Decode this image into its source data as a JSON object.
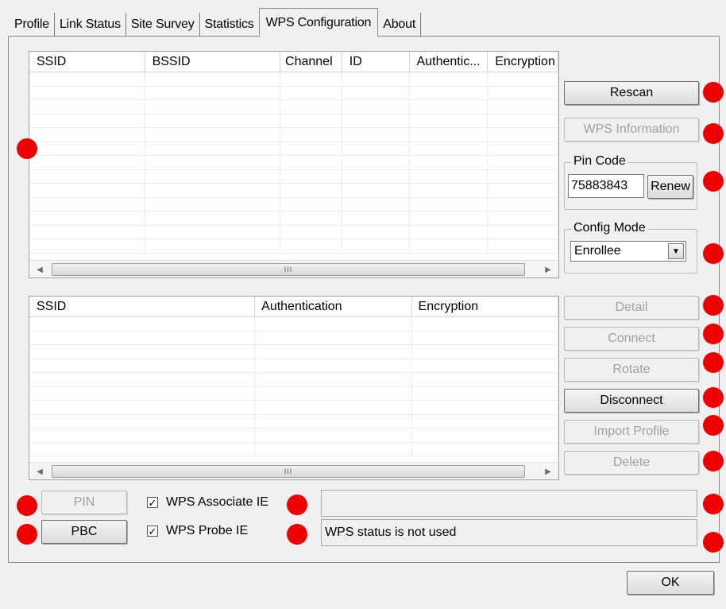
{
  "tabs": [
    {
      "label": "Profile"
    },
    {
      "label": "Link Status"
    },
    {
      "label": "Site Survey"
    },
    {
      "label": "Statistics"
    },
    {
      "label": "WPS Configuration"
    },
    {
      "label": "About"
    }
  ],
  "ap_list": {
    "columns": [
      "SSID",
      "BSSID",
      "Channel",
      "ID",
      "Authentic...",
      "Encryption"
    ],
    "scroll_grip": "III"
  },
  "profile_list": {
    "columns": [
      "SSID",
      "Authentication",
      "Encryption"
    ],
    "scroll_grip": "III"
  },
  "buttons": {
    "rescan": "Rescan",
    "wps_information": "WPS Information",
    "renew": "Renew",
    "detail": "Detail",
    "connect": "Connect",
    "rotate": "Rotate",
    "disconnect": "Disconnect",
    "import_profile": "Import Profile",
    "delete": "Delete",
    "pin": "PIN",
    "pbc": "PBC",
    "ok": "OK"
  },
  "pin_code": {
    "label": "Pin Code",
    "value": "75883843"
  },
  "config_mode": {
    "label": "Config Mode",
    "selected": "Enrollee"
  },
  "checkboxes": {
    "wps_associate_ie": "WPS Associate IE",
    "wps_probe_ie": "WPS Probe IE"
  },
  "status": {
    "line1": "",
    "line2": "WPS status is not used"
  },
  "colors": {
    "marker": "#ee0000"
  }
}
